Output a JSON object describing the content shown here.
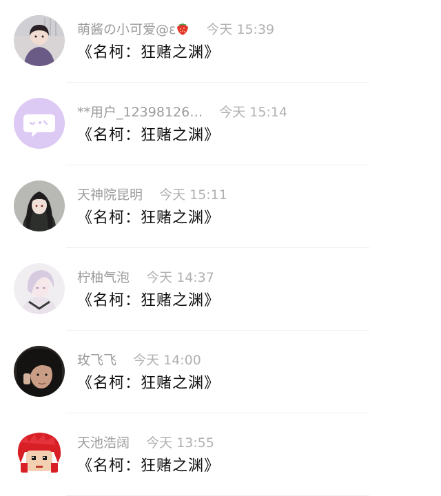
{
  "comments": [
    {
      "avatar": "girl-purple-hoodie-avatar",
      "name": "萌酱の小可爱@ε",
      "time": "今天 15:39",
      "text": "《名柯：狂赌之渊》",
      "badge": "strawberry-icon"
    },
    {
      "avatar": "default-chat-bubble-avatar",
      "name": "**用户_12398126…",
      "time": "今天 15:14",
      "text": "《名柯：狂赌之渊》"
    },
    {
      "avatar": "anime-girl-dark-hair-avatar",
      "name": "天神院昆明",
      "time": "今天 15:11",
      "text": "《名柯：狂赌之渊》"
    },
    {
      "avatar": "anime-boy-silver-hair-avatar",
      "name": "柠柚气泡",
      "time": "今天 14:37",
      "text": "《名柯：狂赌之渊》"
    },
    {
      "avatar": "black-hair-portrait-avatar",
      "name": "玫飞飞",
      "time": "今天 14:00",
      "text": "《名柯：狂赌之渊》"
    },
    {
      "avatar": "red-hair-pixel-avatar",
      "name": "天池浩阔",
      "time": "今天 13:55",
      "text": "《名柯：狂赌之渊》"
    }
  ],
  "colors": {
    "meta": "#a6a6a6",
    "text": "#111111",
    "divider": "#efefef",
    "default_avatar": "#dcc9f4"
  }
}
